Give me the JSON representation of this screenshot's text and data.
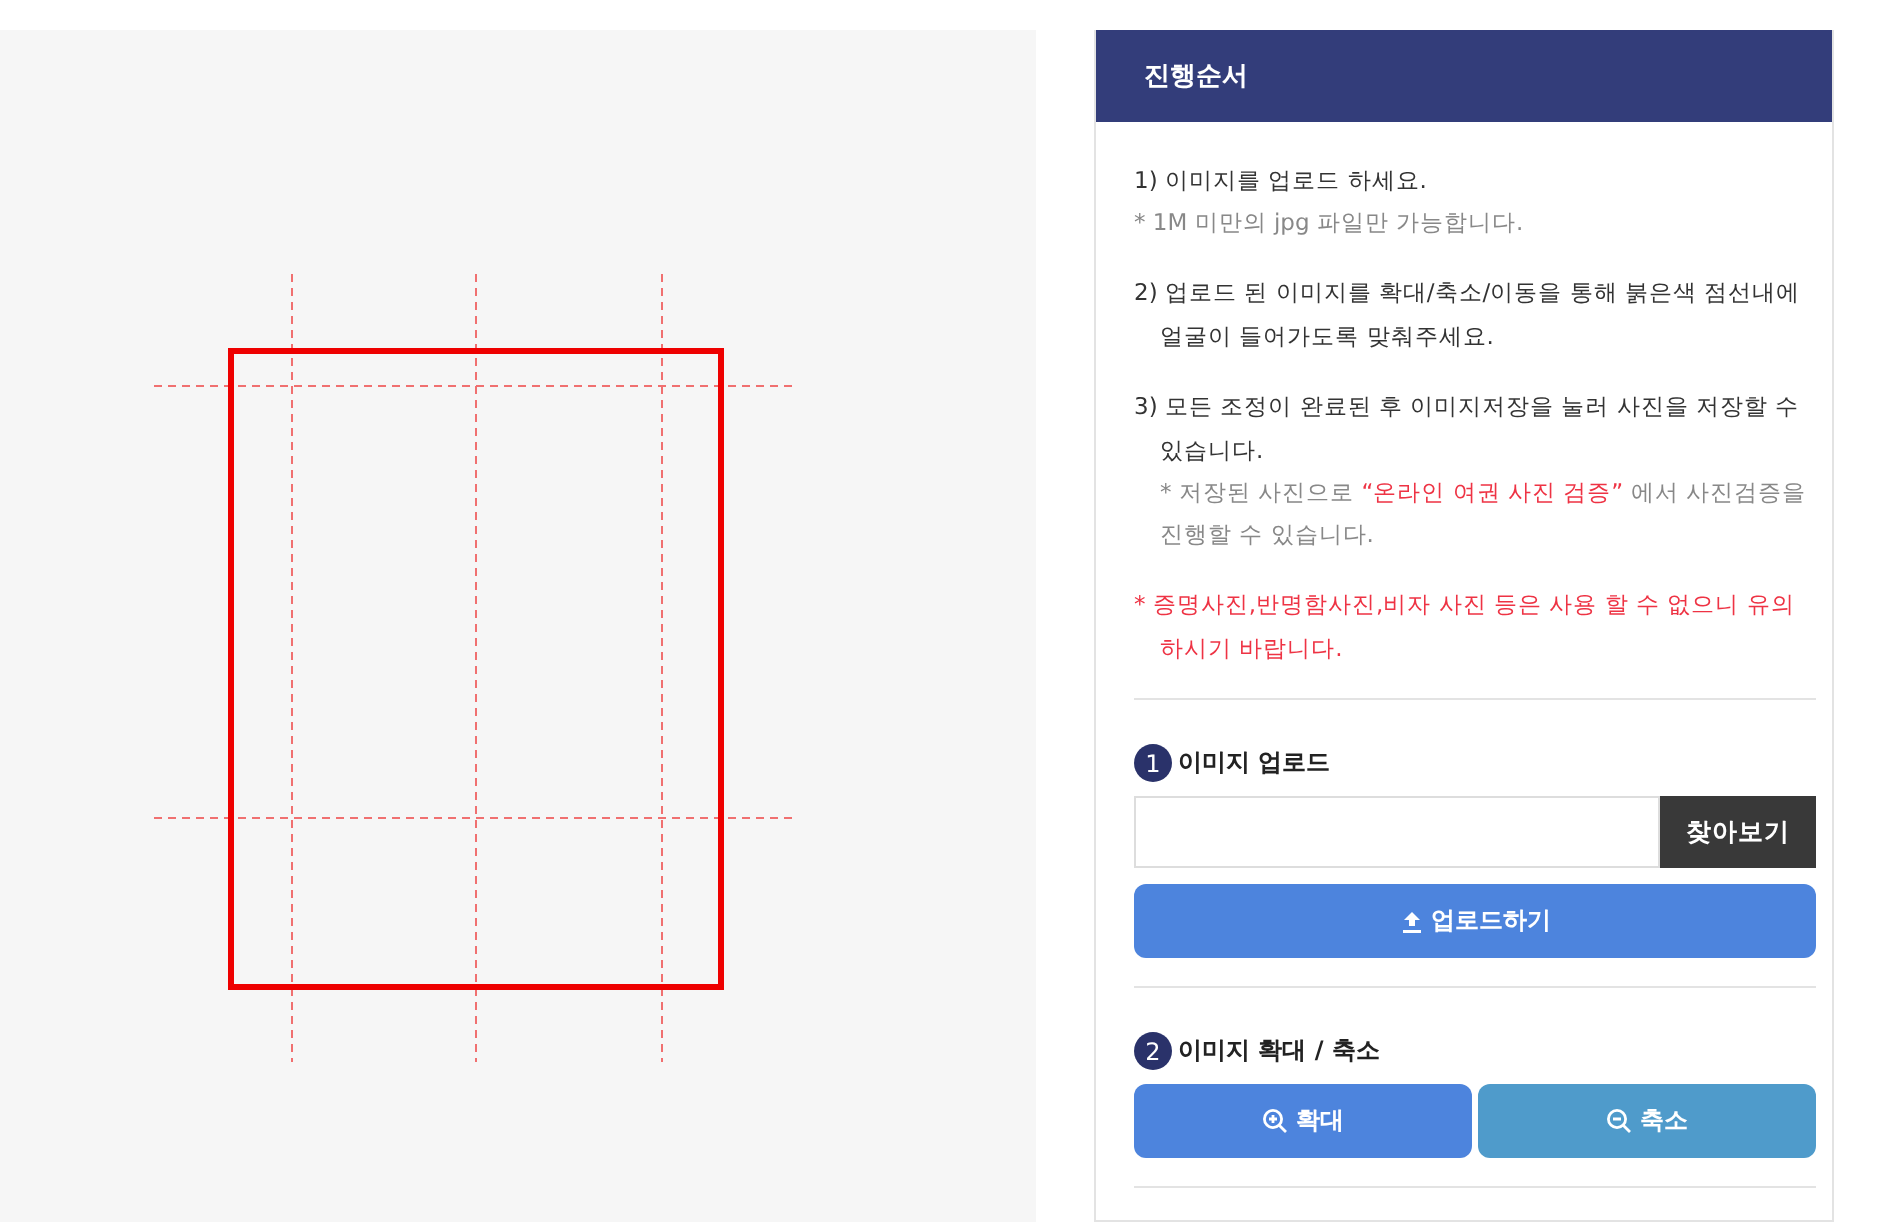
{
  "canvas": {
    "kind": "crop-guide"
  },
  "panel": {
    "title": "진행순서",
    "steps": [
      {
        "text": "1) 이미지를 업로드 하세요.",
        "note": {
          "before": "* 1M 미만의 jpg 파일만 가능합니다."
        }
      },
      {
        "text": "2) 업로드 된 이미지를 확대/축소/이동을 통해 붉은색 점선내에 얼굴이 들어가도록 맞춰주세요."
      },
      {
        "text": "3) 모든 조정이 완료된 후 이미지저장을 눌러 사진을 저장할 수 있습니다.",
        "note": {
          "before": "* 저장된 사진으로 ",
          "highlight": "“온라인 여권 사진 검증”",
          "after": " 에서 사진검증을 진행할 수 있습니다."
        }
      }
    ],
    "warning": "* 증명사진,반명함사진,비자 사진 등은 사용 할 수 없으니 유의하시기 바랍니다.",
    "sections": [
      {
        "number": "1",
        "title": "이미지 업로드",
        "kind": "upload",
        "browse": "찾아보기",
        "upload": "업로드하기"
      },
      {
        "number": "2",
        "title": "이미지 확대 / 축소",
        "kind": "zoom",
        "zoom_in": "확대",
        "zoom_out": "축소"
      }
    ]
  }
}
